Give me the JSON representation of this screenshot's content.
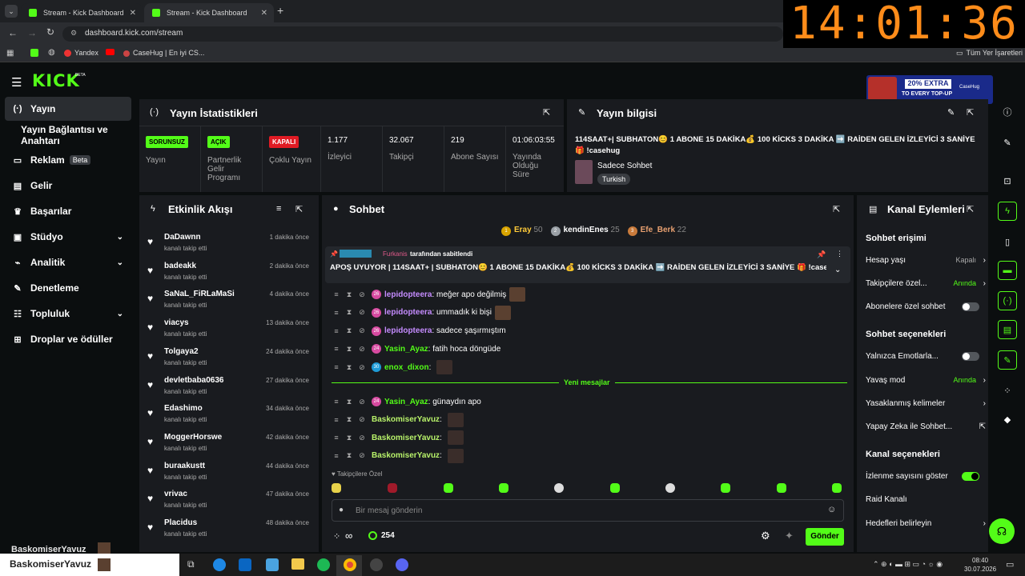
{
  "browser": {
    "tabs": [
      {
        "label": "Stream - Kick Dashboard"
      },
      {
        "label": "Stream - Kick Dashboard"
      }
    ],
    "url": "dashboard.kick.com/stream",
    "bookmarks": [
      "Yandex",
      "CaseHug | En iyi CS..."
    ],
    "bookmarks_right": "Tüm Yer İşaretleri"
  },
  "overlay_clock": "14:01:36",
  "app": {
    "logo": "KICK",
    "logo_tag": "BETA",
    "promo": {
      "line1": "20% EXTRA",
      "line2": "TO EVERY TOP-UP",
      "brand": "CaseHug"
    }
  },
  "sidebar": {
    "items": [
      {
        "label": "Yayın"
      },
      {
        "label": "Yayın Bağlantısı ve Anahtarı"
      },
      {
        "label": "Reklam",
        "badge": "Beta"
      },
      {
        "label": "Gelir"
      },
      {
        "label": "Başarılar"
      },
      {
        "label": "Stüdyo"
      },
      {
        "label": "Analitik"
      },
      {
        "label": "Denetleme"
      },
      {
        "label": "Topluluk"
      },
      {
        "label": "Droplar ve ödüller"
      }
    ],
    "user": "BaskomiserYavuz"
  },
  "stats": {
    "title": "Yayın İstatistikleri",
    "cells": [
      {
        "badge": "SORUNSUZ",
        "label": "Yayın"
      },
      {
        "badge": "AÇIK",
        "label": "Partnerlik Gelir Programı"
      },
      {
        "badge": "KAPALI",
        "label": "Çoklu Yayın"
      },
      {
        "value": "1.177",
        "label": "İzleyici"
      },
      {
        "value": "32.067",
        "label": "Takipçi"
      },
      {
        "value": "219",
        "label": "Abone Sayısı"
      },
      {
        "value": "01:06:03:55",
        "label": "Yayında Olduğu Süre"
      }
    ]
  },
  "stream_info": {
    "title": "Yayın bilgisi",
    "stream_title": "114SAAT+| SUBHATON😊 1 ABONE 15 DAKİKA💰 100 KİCKS 3 DAKİKA ➡️ RAİDEN GELEN İZLEYİCİ 3 SANİYE 🎁 !casehug",
    "category": "Sadece Sohbet",
    "language": "Turkish"
  },
  "activity": {
    "title": "Etkinlik Akışı",
    "items": [
      {
        "name": "DaDawnn",
        "sub": "kanalı takip etti",
        "time": "1 dakika önce"
      },
      {
        "name": "badeakk",
        "sub": "kanalı takip etti",
        "time": "2 dakika önce"
      },
      {
        "name": "SaNaL_FiRLaMaSi",
        "sub": "kanalı takip etti",
        "time": "4 dakika önce"
      },
      {
        "name": "viacys",
        "sub": "kanalı takip etti",
        "time": "13 dakika önce"
      },
      {
        "name": "Tolgaya2",
        "sub": "kanalı takip etti",
        "time": "24 dakika önce"
      },
      {
        "name": "devletbaba0636",
        "sub": "kanalı takip etti",
        "time": "27 dakika önce"
      },
      {
        "name": "Edashimo",
        "sub": "kanalı takip etti",
        "time": "34 dakika önce"
      },
      {
        "name": "MoggerHorswe",
        "sub": "kanalı takip etti",
        "time": "42 dakika önce"
      },
      {
        "name": "buraakustt",
        "sub": "kanalı takip etti",
        "time": "44 dakika önce"
      },
      {
        "name": "vrivac",
        "sub": "kanalı takip etti",
        "time": "47 dakika önce"
      },
      {
        "name": "Placidus",
        "sub": "kanalı takip etti",
        "time": "48 dakika önce"
      }
    ]
  },
  "chat": {
    "title": "Sohbet",
    "leaders": [
      {
        "rank": "1",
        "name": "Eray",
        "count": "50"
      },
      {
        "rank": "2",
        "name": "kendinEnes",
        "count": "25"
      },
      {
        "rank": "3",
        "name": "Efe_Berk",
        "count": "22"
      }
    ],
    "pinned_by": "Furkanis",
    "pinned_suffix": "tarafından sabitlendi",
    "pinned_text": "APOŞ UYUYOR | 114SAAT+ | SUBHATON😊 1 ABONE 15 DAKİKA💰 100 KİCKS 3 DAKİKA ➡️ RAİDEN GELEN İZLEYİCİ 3 SANİYE 🎁 !casehug",
    "messages": [
      {
        "level": "26",
        "user": "lepidopteera",
        "text": "meğer apo değilmiş",
        "color": "#c58cff"
      },
      {
        "level": "26",
        "user": "lepidopteera",
        "text": "ummadık ki bişi",
        "color": "#c58cff"
      },
      {
        "level": "26",
        "user": "lepidopteera",
        "text": "sadece şaşırmıştım",
        "color": "#c58cff"
      },
      {
        "level": "24",
        "user": "Yasin_Ayaz",
        "text": "fatih hoca döngüde",
        "color": "#53fc18"
      },
      {
        "level": "30",
        "user": "enox_dixon",
        "text": "",
        "color": "#53fc18"
      }
    ],
    "new_messages_label": "Yeni mesajlar",
    "new_messages": [
      {
        "level": "24",
        "user": "Yasin_Ayaz",
        "text": "günaydın apo",
        "color": "#53fc18"
      },
      {
        "level": "",
        "user": "BaskomiserYavuz",
        "text": "",
        "color": "#b8f26a"
      },
      {
        "level": "",
        "user": "BaskomiserYavuz",
        "text": "",
        "color": "#b8f26a"
      },
      {
        "level": "",
        "user": "BaskomiserYavuz",
        "text": "",
        "color": "#b8f26a"
      }
    ],
    "followers_only": "Takipçilere Özel",
    "input_placeholder": "Bir mesaj gönderin",
    "points": "254",
    "infinity": "∞",
    "send": "Gönder"
  },
  "channel_actions": {
    "title": "Kanal Eylemleri",
    "chat_access": {
      "header": "Sohbet erişimi",
      "account_age": {
        "label": "Hesap yaşı",
        "value": "Kapalı"
      },
      "followers_only": {
        "label": "Takipçilere özel...",
        "value": "Anında"
      },
      "subscribers_only": {
        "label": "Abonelere özel sohbet"
      }
    },
    "chat_options": {
      "header": "Sohbet seçenekleri",
      "emote_only": {
        "label": "Yalnızca Emotlarla..."
      },
      "slow_mode": {
        "label": "Yavaş mod",
        "value": "Anında"
      },
      "banned_words": {
        "label": "Yasaklanmış kelimeler"
      },
      "ai_chat": {
        "label": "Yapay Zeka ile Sohbet..."
      }
    },
    "channel_options": {
      "header": "Kanal seçenekleri",
      "show_viewers": {
        "label": "İzlenme sayısını göster"
      },
      "raid": {
        "label": "Raid Kanalı"
      },
      "goals": {
        "label": "Hedefleri belirleyin"
      }
    }
  },
  "taskbar": {
    "user": "BaskomiserYavuz",
    "time": "08:40",
    "date": "30.07.2026"
  },
  "colors": {
    "accent": "#53fc18",
    "panel": "#191b1f",
    "bg": "#0b0e0f"
  }
}
